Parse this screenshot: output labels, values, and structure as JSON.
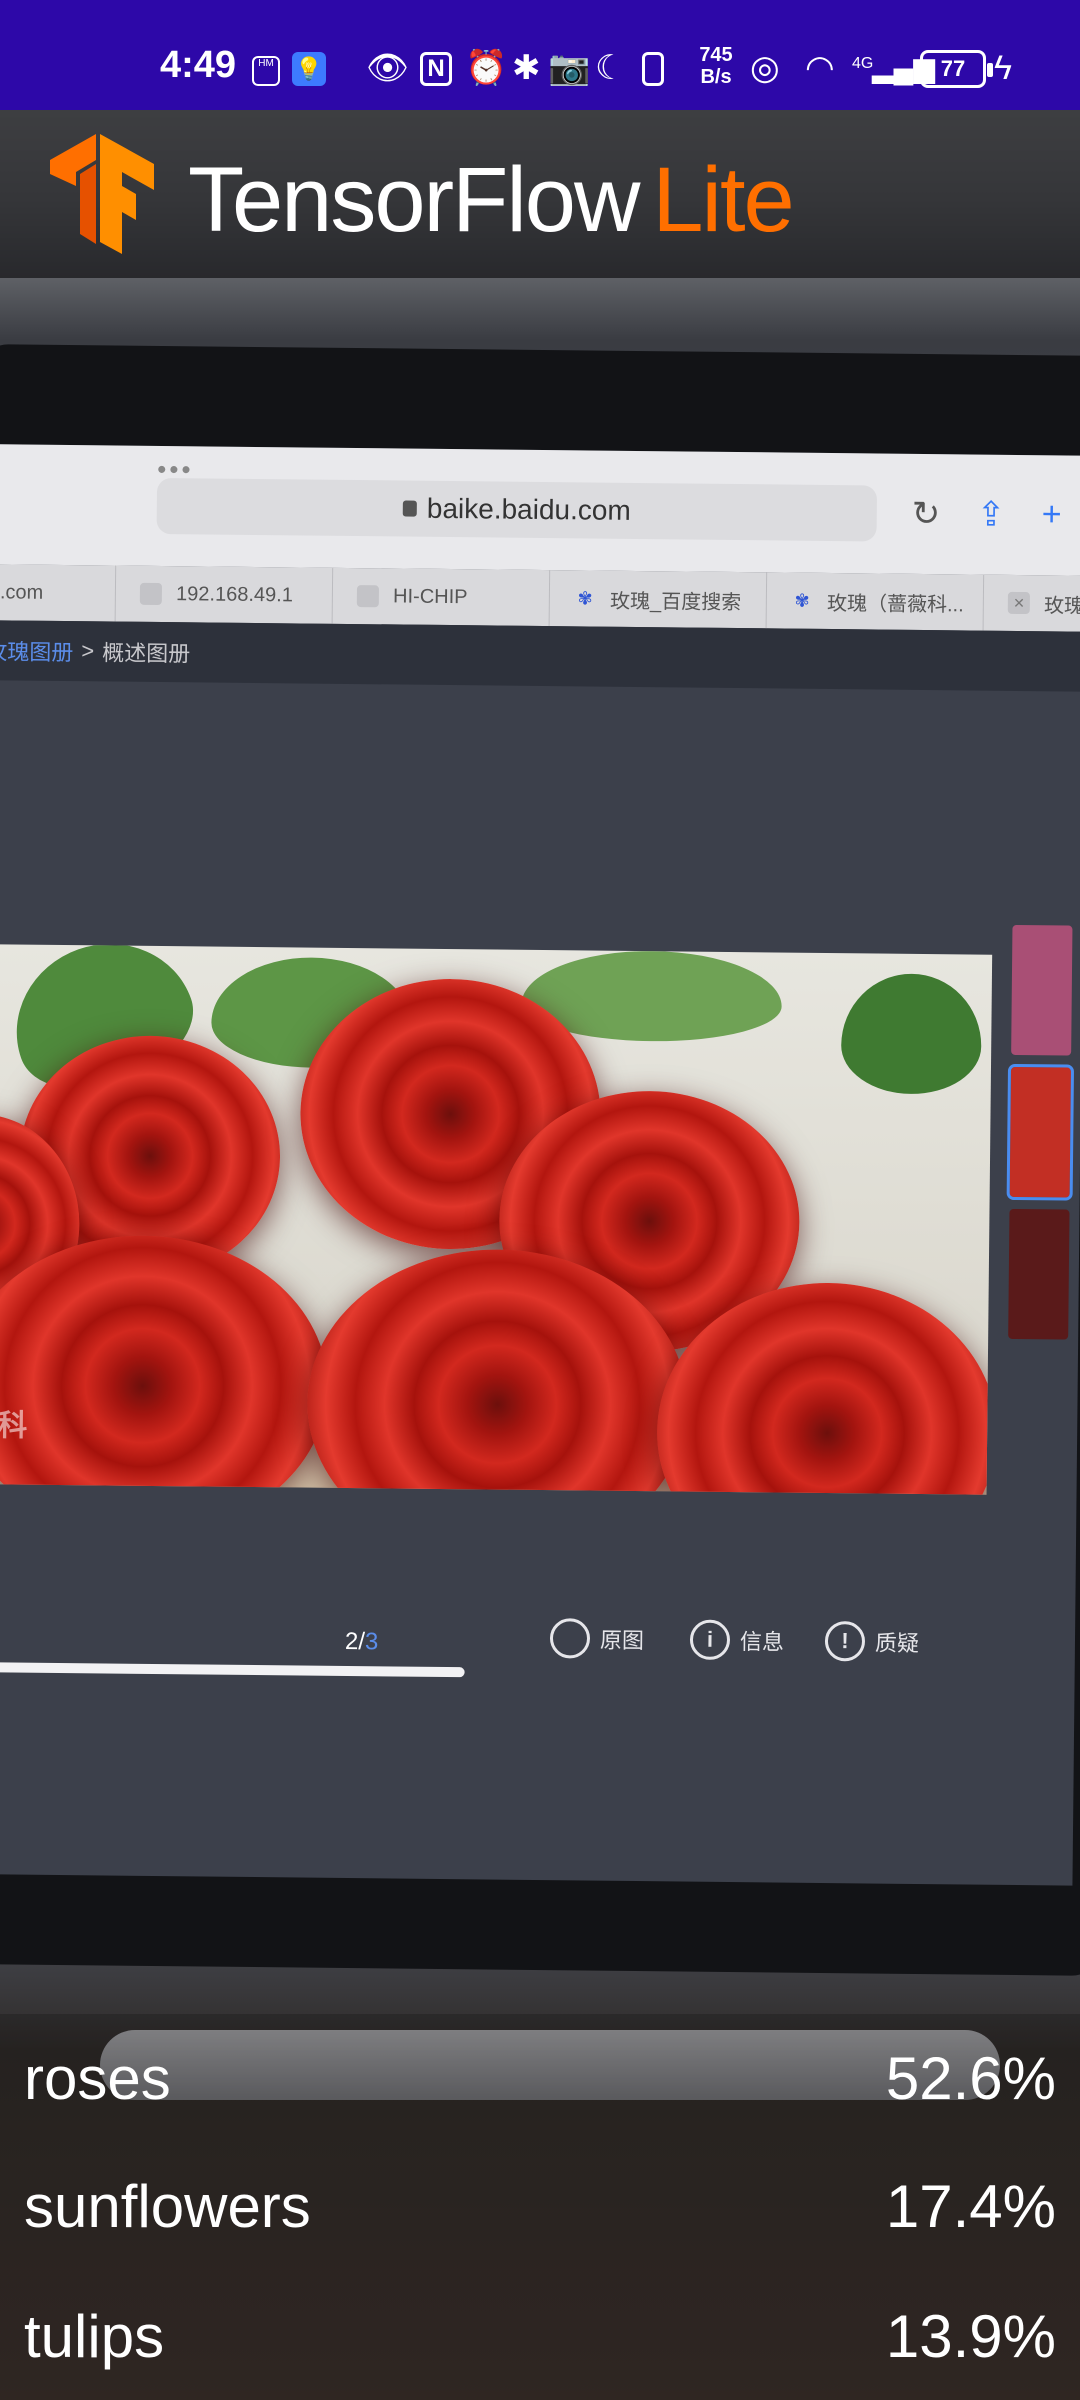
{
  "status_bar": {
    "time": "4:49",
    "net_speed_value": "745",
    "net_speed_unit": "B/s",
    "battery_level": "77",
    "signal_type": "4G",
    "icons": [
      "hmos-icon",
      "bulb-icon",
      "eye-icon",
      "nfc-icon",
      "alarm-icon",
      "bluetooth-icon",
      "camera-icon",
      "moon-icon",
      "vibrate-icon",
      "hotspot-icon",
      "wifi-icon",
      "signal-icon",
      "battery-icon",
      "charging-icon"
    ],
    "background_color": "#2d08a8"
  },
  "app_bar": {
    "title_part1": "TensorFlow",
    "title_part2": "Lite",
    "logo_icon": "tensorflow-logo-icon",
    "accent_color": "#ff6f00"
  },
  "camera_preview": {
    "browser_url": "baike.baidu.com",
    "tabs": [
      {
        "label": ".com"
      },
      {
        "label": "192.168.49.1"
      },
      {
        "label": "HI-CHIP"
      },
      {
        "label": "玫瑰_百度搜索"
      },
      {
        "label": "玫瑰（蔷薇科..."
      },
      {
        "label": "玫瑰"
      }
    ],
    "breadcrumb_link": "玫瑰图册",
    "breadcrumb_sep": ">",
    "breadcrumb_current": "概述图册",
    "watermark": "百科",
    "gallery_counter_current": "2/",
    "gallery_counter_total": "3",
    "gallery_progress": 0.45,
    "toolbar": {
      "original_label": "原图",
      "info_label": "信息",
      "dispute_label": "质疑"
    }
  },
  "results": [
    {
      "label": "roses",
      "score": "52.6%"
    },
    {
      "label": "sunflowers",
      "score": "17.4%"
    },
    {
      "label": "tulips",
      "score": "13.9%"
    }
  ]
}
